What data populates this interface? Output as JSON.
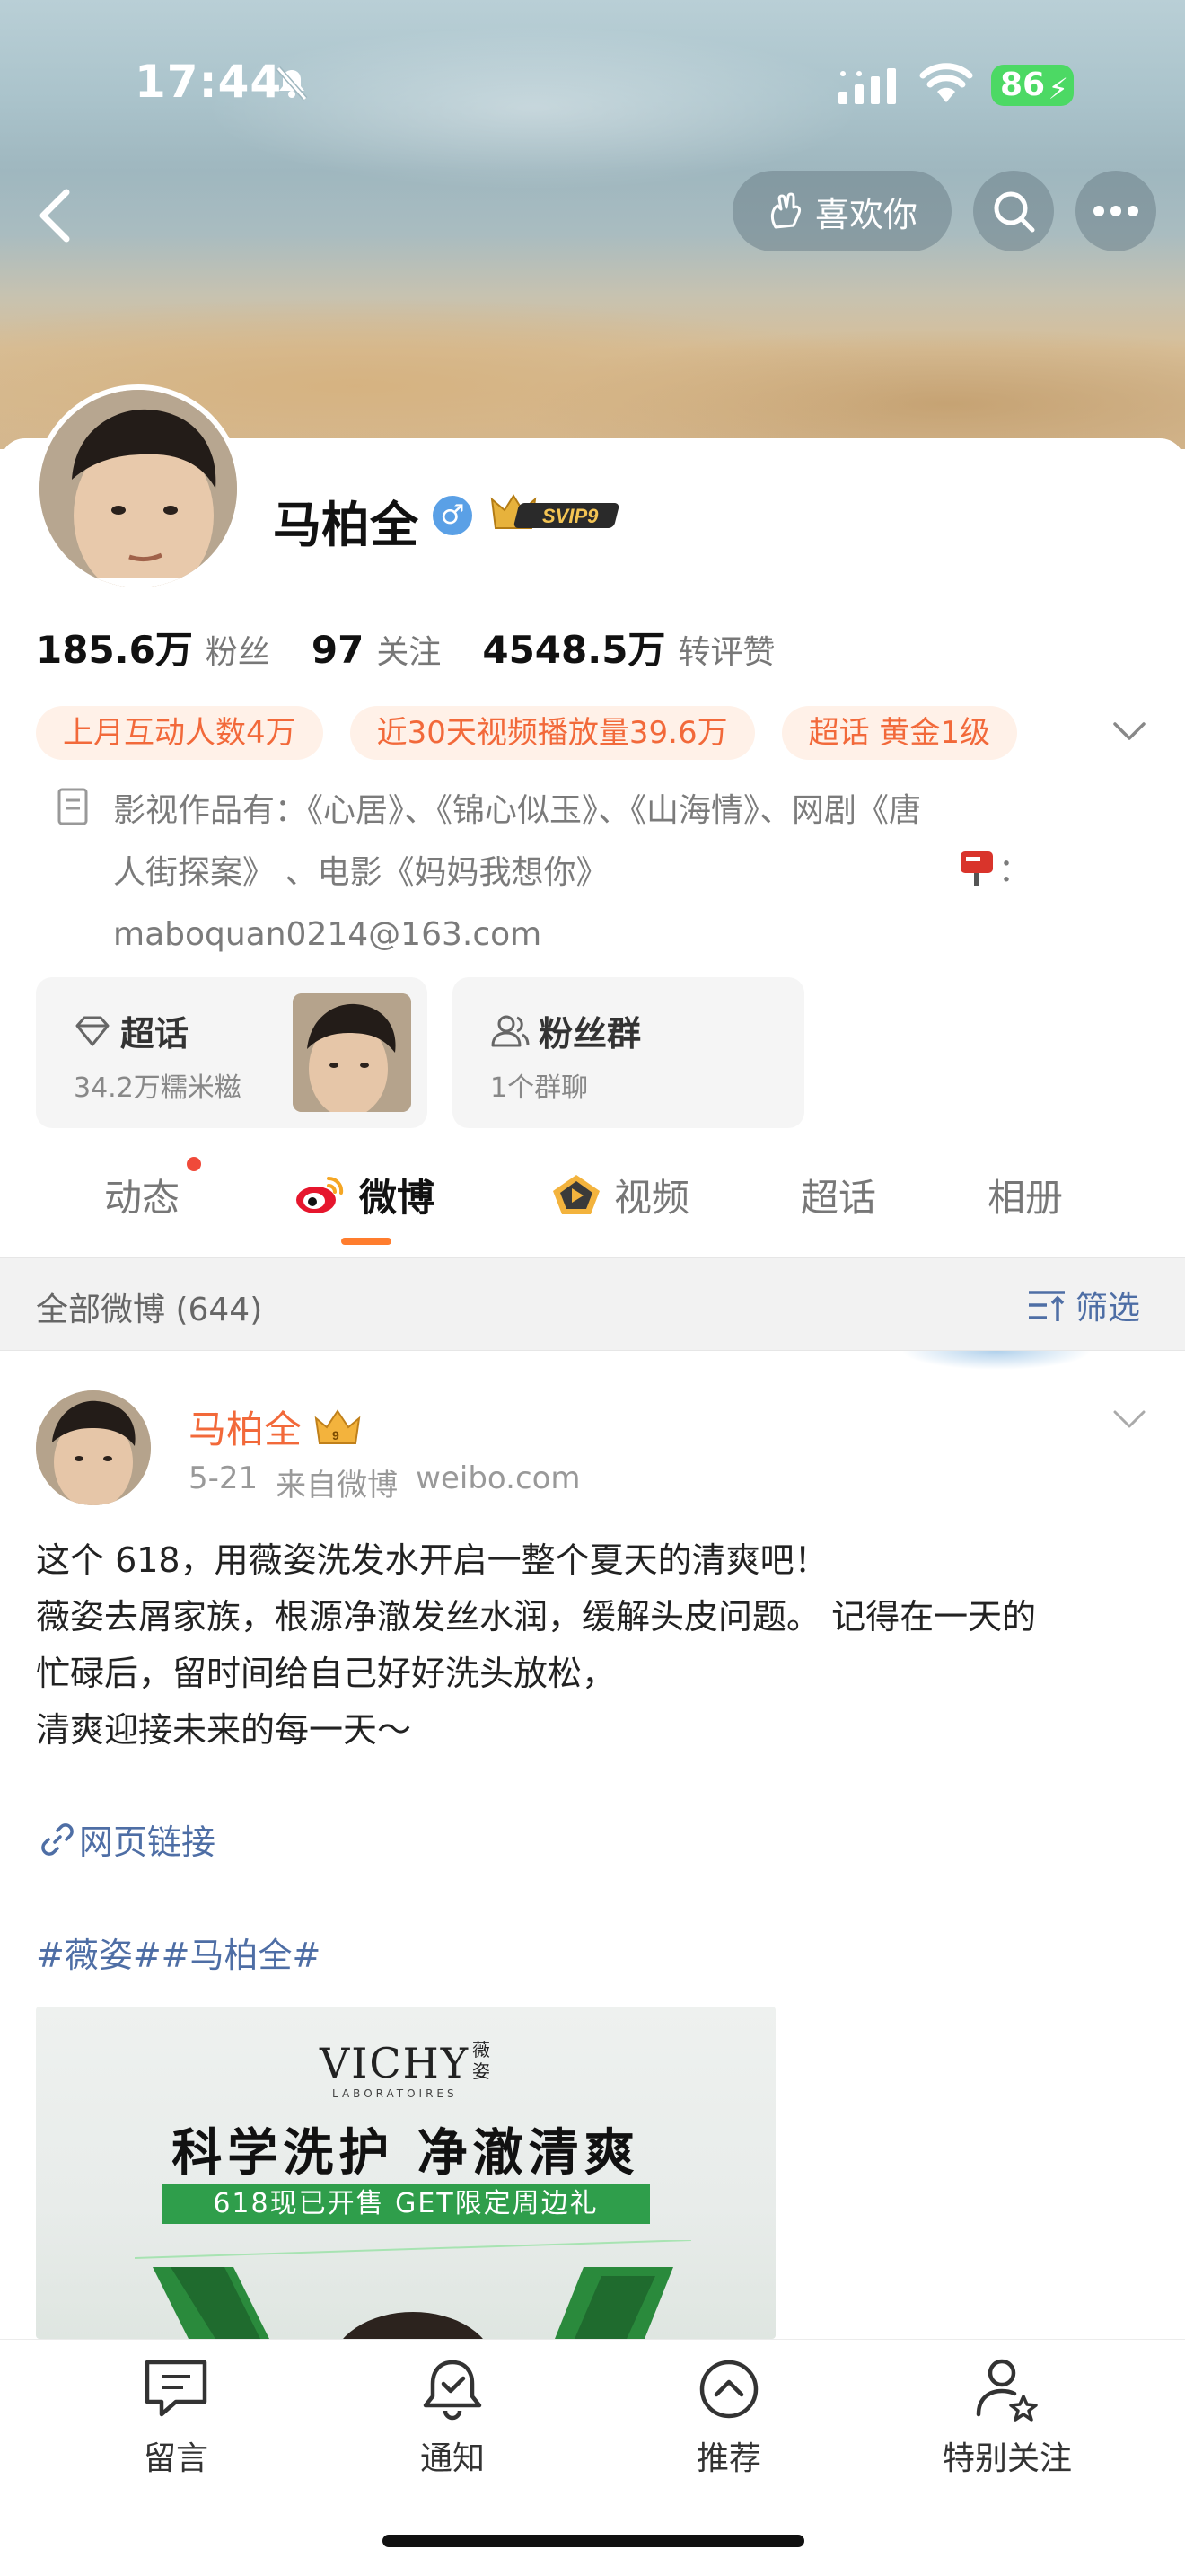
{
  "status_bar": {
    "time": "17:44",
    "battery": "86"
  },
  "header": {
    "like_label": "喜欢你"
  },
  "profile": {
    "name": "马柏全",
    "vip_label": "SVIP9",
    "stats": [
      {
        "num": "185.6万",
        "label": "粉丝"
      },
      {
        "num": "97",
        "label": "关注"
      },
      {
        "num": "4548.5万",
        "label": "转评赞"
      }
    ],
    "tags": [
      "上月互动人数4万",
      "近30天视频播放量39.6万",
      "超话 黄金1级"
    ],
    "bio_line1": "影视作品有：《心居》、《锦心似玉》、《山海情》、网剧《唐",
    "bio_line2": "人街探案》 、电影《妈妈我想你》",
    "bio_colon": "：",
    "bio_line3": "maboquan0214@163.com"
  },
  "cards": {
    "super_title": "超话",
    "super_sub": "34.2万糯米糍",
    "fans_title": "粉丝群",
    "fans_sub": "1个群聊"
  },
  "tabs": [
    "动态",
    "微博",
    "视频",
    "超话",
    "相册"
  ],
  "filter": {
    "left": "全部微博 (644)",
    "right": "筛选"
  },
  "post": {
    "author": "马柏全",
    "date": "5-21",
    "source": "来自微博",
    "source_domain": "weibo.com",
    "line1": "这个 618，用薇姿洗发水开启一整个夏天的清爽吧！",
    "line2": "薇姿去屑家族，根源净澈发丝水润，缓解头皮问题。 记得在一天的",
    "line3": "忙碌后，留时间给自己好好洗头放松，",
    "line4": "清爽迎接未来的每一天～",
    "link_label": "网页链接",
    "hashtags": "#薇姿##马柏全#",
    "image": {
      "brand": "VICHY",
      "brand_cn": "薇姿",
      "brand_sub": "LABORATOIRES",
      "headline": "科学洗护 净澈清爽",
      "promo": "618现已开售 GET限定周边礼"
    }
  },
  "bottom_nav": [
    "留言",
    "通知",
    "推荐",
    "特别关注"
  ],
  "colors": {
    "accent": "#ff7d2e",
    "link": "#4e6ea5",
    "tag_text": "#f2693a",
    "tag_bg": "#fff1e8"
  }
}
